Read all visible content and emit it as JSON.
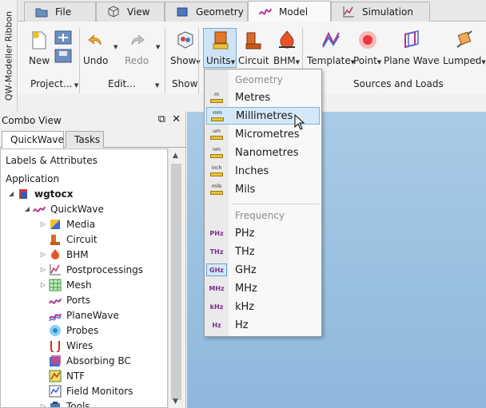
{
  "ribbon_side_label": "QW-Modeller Ribbon",
  "tabs": [
    {
      "label": "File",
      "icon": "folder-icon"
    },
    {
      "label": "View",
      "icon": "cube-view-icon"
    },
    {
      "label": "Geometry",
      "icon": "geometry-icon"
    },
    {
      "label": "Model",
      "icon": "qw-model-icon",
      "active": true
    },
    {
      "label": "Simulation",
      "icon": "simulation-chart-icon"
    }
  ],
  "ribbon": {
    "buttons": {
      "new": "New",
      "undo": "Undo",
      "redo": "Redo",
      "show": "Show",
      "units": "Units",
      "circuit": "Circuit",
      "bhm": "BHM",
      "template": "Template",
      "point": "Point",
      "plane_wave": "Plane Wave",
      "lumped": "Lumped"
    },
    "groups": {
      "project": "Project...",
      "edit": "Edit...",
      "show": "Show",
      "sources": "Sources and Loads"
    }
  },
  "combo": {
    "title": "Combo View",
    "tabs": [
      "QuickWave",
      "Tasks"
    ],
    "section": "Labels & Attributes",
    "application": "Application",
    "tree": [
      {
        "label": "wgtocx",
        "bold": true,
        "icon": "document-icon"
      },
      {
        "label": "QuickWave",
        "icon": "quickwave-icon"
      },
      {
        "label": "Media",
        "icon": "media-icon"
      },
      {
        "label": "Circuit",
        "icon": "circuit-icon"
      },
      {
        "label": "BHM",
        "icon": "bhm-icon"
      },
      {
        "label": "Postprocessings",
        "icon": "postprocessing-icon"
      },
      {
        "label": "Mesh",
        "icon": "mesh-icon"
      },
      {
        "label": "Ports",
        "icon": "ports-icon"
      },
      {
        "label": "PlaneWave",
        "icon": "planewave-icon"
      },
      {
        "label": "Probes",
        "icon": "probes-icon"
      },
      {
        "label": "Wires",
        "icon": "wires-icon"
      },
      {
        "label": "Absorbing BC",
        "icon": "absorbing-bc-icon"
      },
      {
        "label": "NTF",
        "icon": "ntf-icon"
      },
      {
        "label": "Field Monitors",
        "icon": "field-monitors-icon"
      },
      {
        "label": "Tools",
        "icon": "tools-icon"
      }
    ]
  },
  "units_menu": {
    "geometry_header": "Geometry",
    "geometry": [
      {
        "label": "Metres",
        "abbr": "m"
      },
      {
        "label": "Millimetres",
        "abbr": "mm"
      },
      {
        "label": "Micrometres",
        "abbr": "um"
      },
      {
        "label": "Nanometres",
        "abbr": "nm"
      },
      {
        "label": "Inches",
        "abbr": "inch"
      },
      {
        "label": "Mils",
        "abbr": "mils"
      }
    ],
    "frequency_header": "Frequency",
    "frequency": [
      {
        "label": "PHz",
        "abbr": "PHz"
      },
      {
        "label": "THz",
        "abbr": "THz"
      },
      {
        "label": "GHz",
        "abbr": "GHz"
      },
      {
        "label": "MHz",
        "abbr": "MHz"
      },
      {
        "label": "kHz",
        "abbr": "kHz"
      },
      {
        "label": "Hz",
        "abbr": "Hz"
      }
    ]
  }
}
